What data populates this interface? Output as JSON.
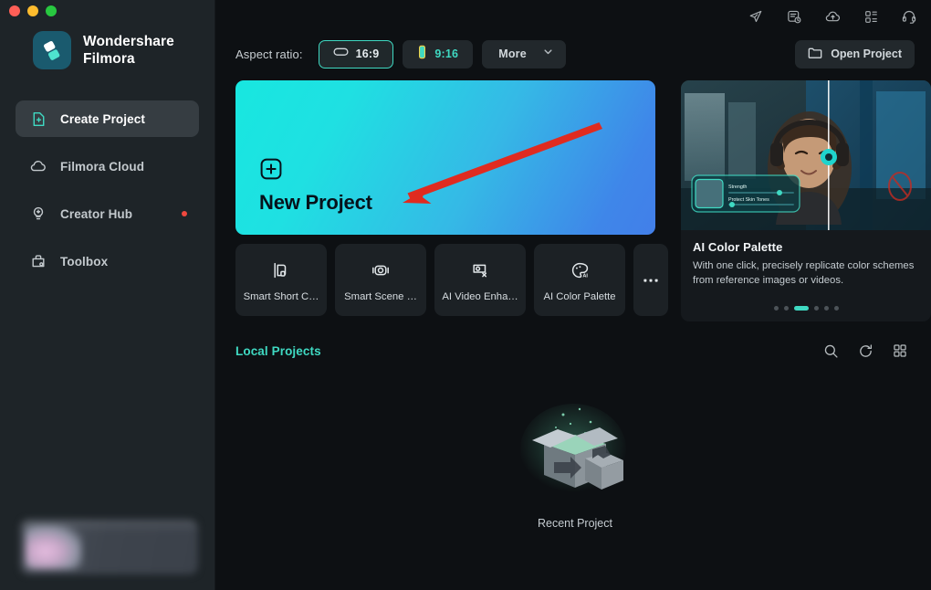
{
  "window": {
    "traffic_lights": [
      "close",
      "minimize",
      "maximize"
    ]
  },
  "sidebar": {
    "brand": {
      "line1": "Wondershare",
      "line2": "Filmora",
      "logo_icon": "filmora-diamond-logo"
    },
    "items": [
      {
        "label": "Create Project",
        "icon": "file-plus-icon",
        "active": true,
        "badge": false
      },
      {
        "label": "Filmora Cloud",
        "icon": "cloud-icon",
        "active": false,
        "badge": false
      },
      {
        "label": "Creator Hub",
        "icon": "lightbulb-icon",
        "active": false,
        "badge": true
      },
      {
        "label": "Toolbox",
        "icon": "toolbox-icon",
        "active": false,
        "badge": false
      }
    ],
    "promo_banner": {
      "name": "blurred-promo-banner"
    }
  },
  "topbar": {
    "icons": [
      {
        "name": "send-icon"
      },
      {
        "name": "task-history-icon"
      },
      {
        "name": "cloud-upload-icon"
      },
      {
        "name": "apps-grid-icon"
      },
      {
        "name": "headset-support-icon"
      }
    ]
  },
  "aspect_ratio": {
    "label": "Aspect ratio:",
    "options": [
      {
        "label": "16:9",
        "icon": "landscape-frame-icon",
        "selected": true
      },
      {
        "label": "9:16",
        "icon": "phone-portrait-icon",
        "selected": false
      }
    ],
    "more": {
      "label": "More",
      "icon": "chevron-down-icon"
    }
  },
  "open_project": {
    "label": "Open Project",
    "icon": "folder-icon"
  },
  "new_project": {
    "title": "New Project",
    "icon": "plus-square-icon",
    "gradient_from": "#18e7e0",
    "gradient_to": "#427fe9"
  },
  "annotation": {
    "type": "red-arrow",
    "color": "#e02b20"
  },
  "promo_card": {
    "title": "AI Color Palette",
    "description": "With one click, precisely replicate color schemes from reference images or videos.",
    "image_name": "ai-color-palette-before-after-preview",
    "overlay": {
      "slider_1_label": "Strength",
      "slider_2_label": "Protect Skin Tones"
    },
    "pagination": {
      "total": 6,
      "active_index": 2,
      "active_color": "#3fd9c2"
    }
  },
  "ai_tools": [
    {
      "label": "Smart Short C…",
      "icon": "smart-short-clips-icon"
    },
    {
      "label": "Smart Scene …",
      "icon": "smart-scene-cut-icon"
    },
    {
      "label": "AI Video Enha…",
      "icon": "ai-video-enhancer-icon"
    },
    {
      "label": "AI Color Palette",
      "icon": "ai-color-palette-icon"
    }
  ],
  "ai_tools_more": {
    "label": "···",
    "icon": "ellipsis-icon"
  },
  "local_projects": {
    "title": "Local Projects",
    "title_color": "#3fd9c2",
    "actions": [
      {
        "name": "search-icon"
      },
      {
        "name": "refresh-icon"
      },
      {
        "name": "grid-view-icon"
      }
    ]
  },
  "empty_state": {
    "label": "Recent Project",
    "illustration": "empty-open-box-illustration"
  }
}
